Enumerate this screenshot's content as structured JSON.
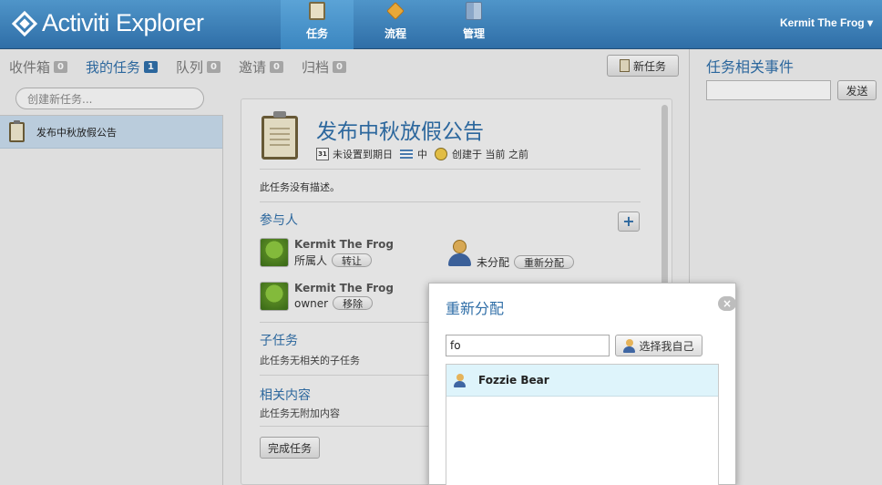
{
  "app": {
    "logo_text": "Activiti Explorer",
    "nav": [
      {
        "label": "任务",
        "icon": "clipboard-icon"
      },
      {
        "label": "流程",
        "icon": "process-icon"
      },
      {
        "label": "管理",
        "icon": "admin-icon"
      }
    ],
    "user": "Kermit The Frog ▾"
  },
  "tabs": [
    {
      "label": "收件箱",
      "count": "0"
    },
    {
      "label": "我的任务",
      "count": "1"
    },
    {
      "label": "队列",
      "count": "0"
    },
    {
      "label": "邀请",
      "count": "0"
    },
    {
      "label": "归档",
      "count": "0"
    }
  ],
  "new_task_label": "新任务",
  "create_task_placeholder": "创建新任务...",
  "task_list": [
    {
      "name": "发布中秋放假公告"
    }
  ],
  "detail": {
    "title": "发布中秋放假公告",
    "calendar_day": "31",
    "due": "未设置到期日",
    "priority": "中",
    "created": "创建于 当前 之前",
    "description": "此任务没有描述。",
    "participants_title": "参与人",
    "participants": [
      {
        "name": "Kermit The Frog",
        "role": "所属人",
        "action": "转让"
      },
      {
        "name": "Kermit The Frog",
        "role": "owner",
        "action": "移除"
      }
    ],
    "unassigned_label": "未分配",
    "reassign_label": "重新分配",
    "subtasks_title": "子任务",
    "subtasks_empty": "此任务无相关的子任务",
    "related_title": "相关内容",
    "related_empty": "此任务无附加内容",
    "complete_label": "完成任务"
  },
  "events": {
    "title": "任务相关事件",
    "send_label": "发送"
  },
  "dialog": {
    "title": "重新分配",
    "close": "×",
    "search_value": "fo",
    "self_label": "选择我自己",
    "results": [
      {
        "name": "Fozzie Bear"
      }
    ]
  }
}
